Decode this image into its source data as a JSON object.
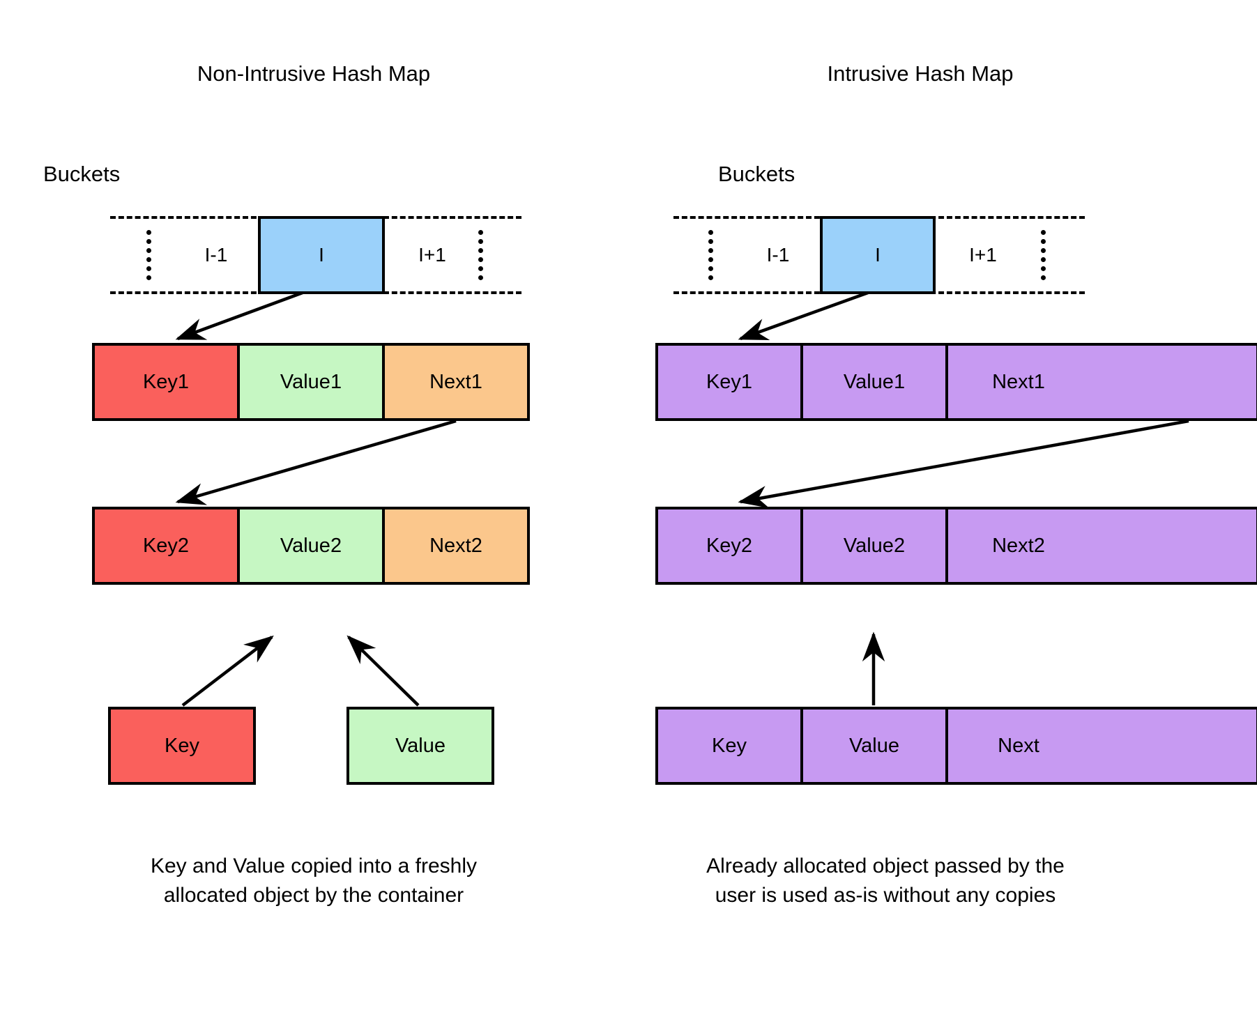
{
  "figure": {
    "background": "#FFFFFF",
    "stroke": "#000000"
  },
  "colors": {
    "bucket_highlight": "#9BD1FA",
    "key": "#FA605C",
    "value": "#C6F7C3",
    "next": "#FBC78C",
    "intrusive_node": "#C79AF2",
    "outline": "#000000"
  },
  "panels": {
    "left": {
      "title": "Non-Intrusive Hash Map",
      "buckets_label": "Buckets",
      "bucket_cells": [
        {
          "label": "I-1",
          "highlighted": false
        },
        {
          "label": "I",
          "highlighted": true
        },
        {
          "label": "I+1",
          "highlighted": false
        }
      ],
      "nodes": [
        {
          "cells": [
            {
              "label": "Key1",
              "role": "key"
            },
            {
              "label": "Value1",
              "role": "value"
            },
            {
              "label": "Next1",
              "role": "next"
            }
          ]
        },
        {
          "cells": [
            {
              "label": "Key2",
              "role": "key"
            },
            {
              "label": "Value2",
              "role": "value"
            },
            {
              "label": "Next2",
              "role": "next"
            }
          ]
        }
      ],
      "user_objects": [
        {
          "label": "Key",
          "role": "key"
        },
        {
          "label": "Value",
          "role": "value"
        }
      ],
      "caption_line1": "Key and Value copied into a freshly",
      "caption_line2": "allocated object by the container"
    },
    "right": {
      "title": "Intrusive Hash Map",
      "buckets_label": "Buckets",
      "bucket_cells": [
        {
          "label": "I-1",
          "highlighted": false
        },
        {
          "label": "I",
          "highlighted": true
        },
        {
          "label": "I+1",
          "highlighted": false
        }
      ],
      "nodes": [
        {
          "cells": [
            {
              "label": "Key1",
              "role": "intrusive"
            },
            {
              "label": "Value1",
              "role": "intrusive"
            },
            {
              "label": "Next1",
              "role": "intrusive"
            }
          ]
        },
        {
          "cells": [
            {
              "label": "Key2",
              "role": "intrusive"
            },
            {
              "label": "Value2",
              "role": "intrusive"
            },
            {
              "label": "Next2",
              "role": "intrusive"
            }
          ]
        }
      ],
      "user_objects": [
        {
          "cells": [
            {
              "label": "Key",
              "role": "intrusive"
            },
            {
              "label": "Value",
              "role": "intrusive"
            },
            {
              "label": "Next",
              "role": "intrusive"
            }
          ]
        }
      ],
      "caption_line1": "Already allocated object passed by the",
      "caption_line2": "user is used as-is without any copies"
    }
  }
}
